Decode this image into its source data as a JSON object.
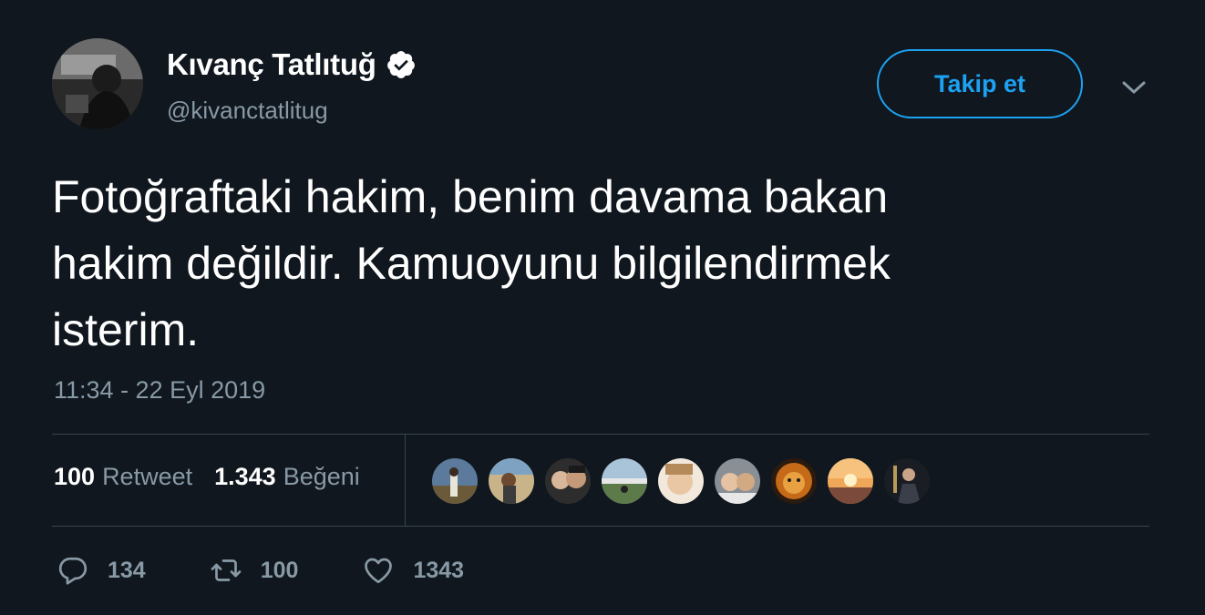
{
  "user": {
    "display_name": "Kıvanç Tatlıtuğ",
    "handle": "@kivanctatlitug",
    "verified": true
  },
  "header": {
    "follow_label": "Takip et"
  },
  "tweet": {
    "text_lines": [
      "Fotoğraftaki hakim, benim davama bakan",
      "hakim değildir. Kamuoyunu bilgilendirmek",
      "isterim."
    ],
    "timestamp": "11:34 - 22 Eyl 2019"
  },
  "stats": {
    "retweet_count": "100",
    "retweet_label": "Retweet",
    "like_count": "1.343",
    "like_label": "Beğeni"
  },
  "likers_count_shown": 9,
  "actions": {
    "reply_count": "134",
    "retweet_count": "100",
    "like_count": "1343"
  },
  "icons": {
    "verified": "verified-badge-icon",
    "menu": "chevron-down-icon",
    "reply": "reply-icon",
    "retweet": "retweet-icon",
    "like": "heart-icon"
  },
  "colors": {
    "background": "#10171e",
    "accent": "#1da1f2",
    "secondary_text": "#8899a6",
    "divider": "#38444d"
  }
}
